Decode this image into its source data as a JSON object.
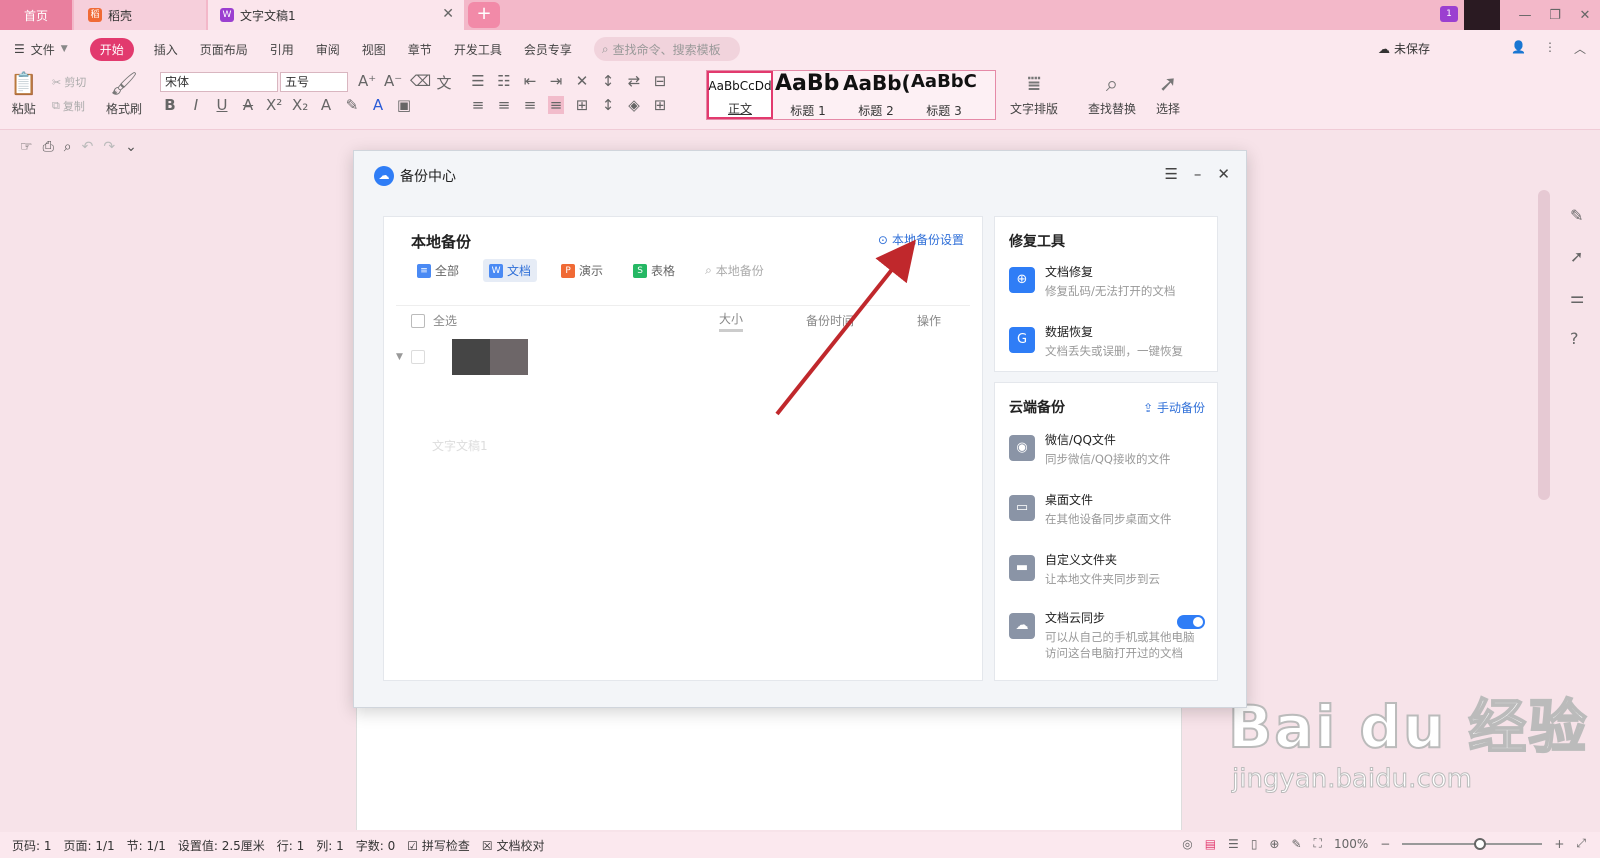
{
  "tabs": {
    "home": "首页",
    "daoke": "稻壳",
    "doc": "文字文稿1"
  },
  "menu": {
    "file": "文件",
    "items": [
      "开始",
      "插入",
      "页面布局",
      "引用",
      "审阅",
      "视图",
      "章节",
      "开发工具",
      "会员专享"
    ],
    "search_placeholder": "查找命令、搜索模板",
    "unsaved": "未保存"
  },
  "ribbon": {
    "paste": "粘贴",
    "cut": "剪切",
    "copy": "复制",
    "format_painter": "格式刷",
    "font": "宋体",
    "size": "五号",
    "styles": [
      {
        "preview": "AaBbCcDd",
        "name": "正文"
      },
      {
        "preview": "AaBb",
        "name": "标题 1"
      },
      {
        "preview": "AaBb(",
        "name": "标题 2"
      },
      {
        "preview": "AaBbC(",
        "name": "标题 3"
      }
    ],
    "text_layout": "文字排版",
    "find_replace": "查找替换",
    "select": "选择"
  },
  "dialog": {
    "title": "备份中心",
    "local": {
      "title": "本地备份",
      "settings": "本地备份设置",
      "filters": [
        {
          "label": "全部",
          "icon": "≡",
          "color": "#4a8af4"
        },
        {
          "label": "文档",
          "icon": "W",
          "color": "#4a8af4"
        },
        {
          "label": "演示",
          "icon": "P",
          "color": "#f06a35"
        },
        {
          "label": "表格",
          "icon": "S",
          "color": "#25b864"
        }
      ],
      "search_placeholder": "本地备份",
      "columns": {
        "select_all": "全选",
        "size": "大小",
        "time": "备份时间",
        "action": "操作"
      },
      "faded_row": "文字文稿1"
    },
    "repair": {
      "title": "修复工具",
      "items": [
        {
          "title": "文档修复",
          "sub": "修复乱码/无法打开的文档"
        },
        {
          "title": "数据恢复",
          "sub": "文档丢失或误删，一键恢复"
        }
      ]
    },
    "cloud": {
      "title": "云端备份",
      "manual": "手动备份",
      "items": [
        {
          "title": "微信/QQ文件",
          "sub": "同步微信/QQ接收的文件"
        },
        {
          "title": "桌面文件",
          "sub": "在其他设备同步桌面文件"
        },
        {
          "title": "自定义文件夹",
          "sub": "让本地文件夹同步到云"
        },
        {
          "title": "文档云同步",
          "sub": "可以从自己的手机或其他电脑访问这台电脑打开过的文档"
        }
      ]
    }
  },
  "status": {
    "page": "页码: 1",
    "pages": "页面: 1/1",
    "section": "节: 1/1",
    "setting": "设置值: 2.5厘米",
    "row": "行: 1",
    "col": "列: 1",
    "words": "字数: 0",
    "spell": "拼写检查",
    "proof": "文档校对",
    "zoom": "100%"
  },
  "watermark": {
    "big": "Bai du 经验",
    "small": "jingyan.baidu.com"
  }
}
